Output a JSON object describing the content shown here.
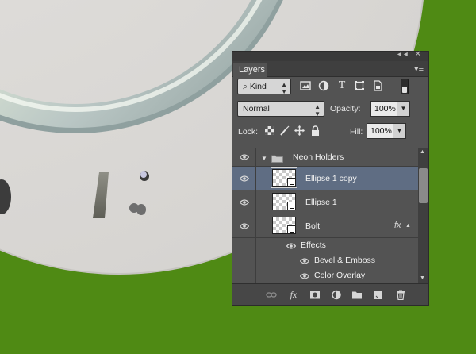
{
  "panel": {
    "tab_label": "Layers",
    "collapse_glyph": "◂◂",
    "close_glyph": "✕",
    "menu_glyph": "▾≡"
  },
  "filter": {
    "kind_label": "Kind",
    "kind_glyph": "⌕",
    "icons": [
      "image-filter-icon",
      "adjustment-filter-icon",
      "type-filter-icon",
      "shape-filter-icon",
      "smart-object-filter-icon"
    ]
  },
  "blend": {
    "mode": "Normal",
    "opacity_label": "Opacity:",
    "opacity_value": "100%"
  },
  "lock": {
    "label": "Lock:",
    "fill_label": "Fill:",
    "fill_value": "100%"
  },
  "layers": [
    {
      "type": "group",
      "name": "Neon Holders",
      "visible": true
    },
    {
      "type": "layer",
      "name": "Ellipse 1 copy",
      "visible": true,
      "selected": true
    },
    {
      "type": "layer",
      "name": "Ellipse 1",
      "visible": true
    },
    {
      "type": "layer",
      "name": "Bolt",
      "visible": true,
      "fx": "fx"
    },
    {
      "type": "effects-header",
      "name": "Effects",
      "visible": true
    },
    {
      "type": "effect",
      "name": "Bevel & Emboss",
      "visible": true
    },
    {
      "type": "effect",
      "name": "Color Overlay",
      "visible": true
    }
  ],
  "footer": {
    "fx_label": "fx",
    "tools": [
      "link-layers-icon",
      "fx-icon",
      "add-mask-icon",
      "adjustment-layer-icon",
      "new-group-icon",
      "new-layer-icon",
      "trash-icon"
    ]
  },
  "colors": {
    "background_green": "#4f8a14",
    "panel_bg": "#535353",
    "selected_row": "#5f6d83"
  }
}
